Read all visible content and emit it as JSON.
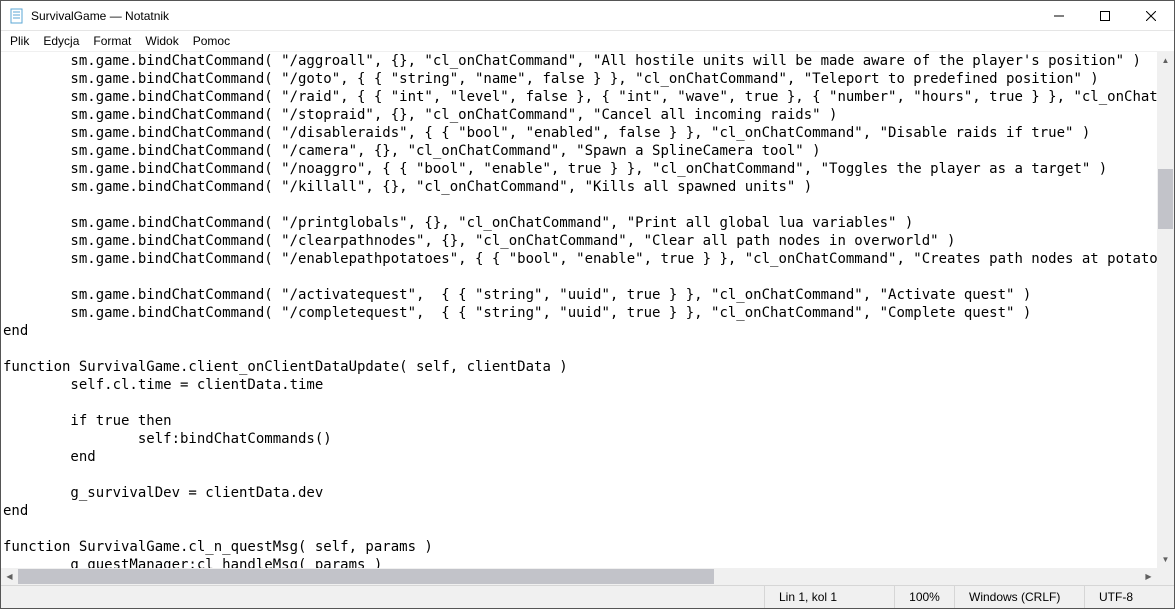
{
  "window": {
    "title": "SurvivalGame — Notatnik"
  },
  "menu": {
    "items": [
      "Plik",
      "Edycja",
      "Format",
      "Widok",
      "Pomoc"
    ]
  },
  "code_lines": [
    "        sm.game.bindChatCommand( \"/aggroall\", {}, \"cl_onChatCommand\", \"All hostile units will be made aware of the player's position\" )",
    "        sm.game.bindChatCommand( \"/goto\", { { \"string\", \"name\", false } }, \"cl_onChatCommand\", \"Teleport to predefined position\" )",
    "        sm.game.bindChatCommand( \"/raid\", { { \"int\", \"level\", false }, { \"int\", \"wave\", true }, { \"number\", \"hours\", true } }, \"cl_onChatCommand\"",
    "        sm.game.bindChatCommand( \"/stopraid\", {}, \"cl_onChatCommand\", \"Cancel all incoming raids\" )",
    "        sm.game.bindChatCommand( \"/disableraids\", { { \"bool\", \"enabled\", false } }, \"cl_onChatCommand\", \"Disable raids if true\" )",
    "        sm.game.bindChatCommand( \"/camera\", {}, \"cl_onChatCommand\", \"Spawn a SplineCamera tool\" )",
    "        sm.game.bindChatCommand( \"/noaggro\", { { \"bool\", \"enable\", true } }, \"cl_onChatCommand\", \"Toggles the player as a target\" )",
    "        sm.game.bindChatCommand( \"/killall\", {}, \"cl_onChatCommand\", \"Kills all spawned units\" )",
    "",
    "        sm.game.bindChatCommand( \"/printglobals\", {}, \"cl_onChatCommand\", \"Print all global lua variables\" )",
    "        sm.game.bindChatCommand( \"/clearpathnodes\", {}, \"cl_onChatCommand\", \"Clear all path nodes in overworld\" )",
    "        sm.game.bindChatCommand( \"/enablepathpotatoes\", { { \"bool\", \"enable\", true } }, \"cl_onChatCommand\", \"Creates path nodes at potato hits in",
    "",
    "        sm.game.bindChatCommand( \"/activatequest\",  { { \"string\", \"uuid\", true } }, \"cl_onChatCommand\", \"Activate quest\" )",
    "        sm.game.bindChatCommand( \"/completequest\",  { { \"string\", \"uuid\", true } }, \"cl_onChatCommand\", \"Complete quest\" )",
    "end",
    "",
    "function SurvivalGame.client_onClientDataUpdate( self, clientData )",
    "        self.cl.time = clientData.time",
    "",
    "        if true then",
    "                self:bindChatCommands()",
    "        end",
    "",
    "        g_survivalDev = clientData.dev",
    "end",
    "",
    "function SurvivalGame.cl_n_questMsg( self, params )",
    "        g_questManager:cl_handleMsg( params )"
  ],
  "status": {
    "position": "Lin 1, kol 1",
    "zoom": "100%",
    "line_ending": "Windows (CRLF)",
    "encoding": "UTF-8"
  }
}
